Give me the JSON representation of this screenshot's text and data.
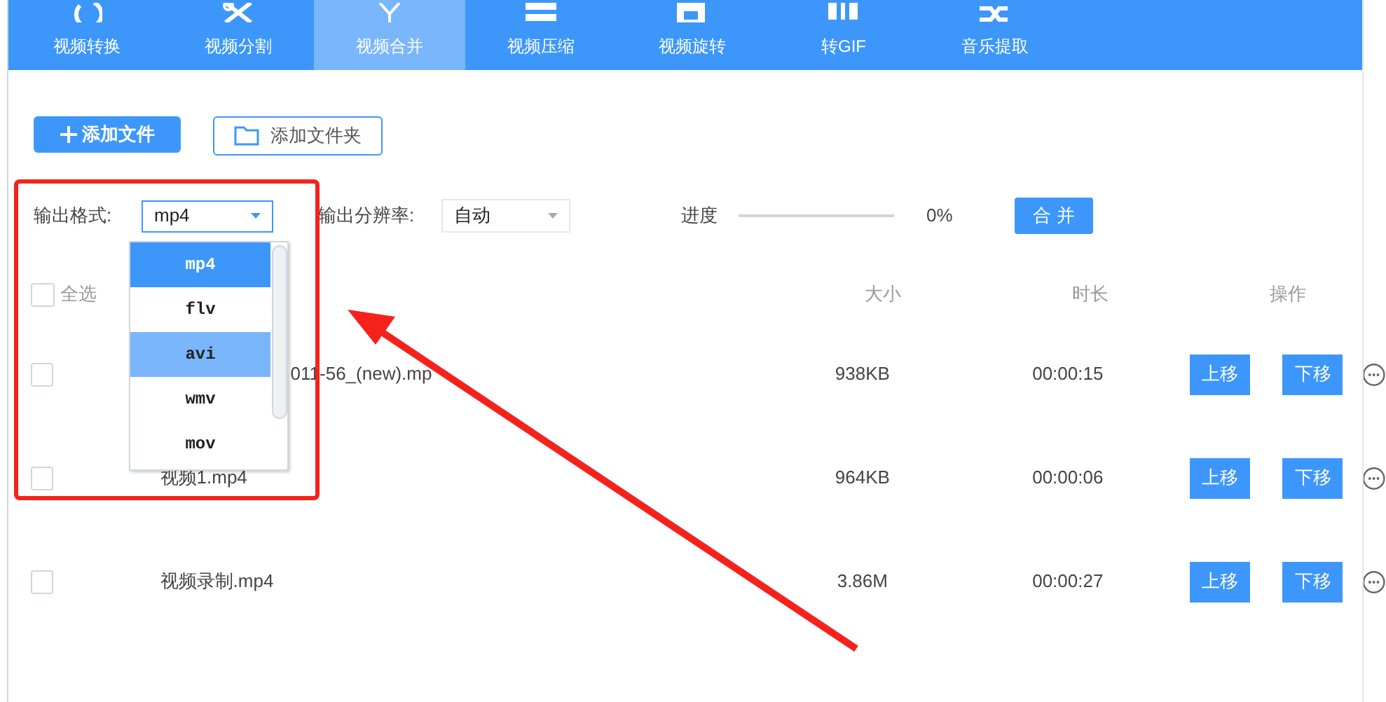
{
  "toolbar": {
    "tabs": [
      {
        "label": "视频转换",
        "selected": false
      },
      {
        "label": "视频分割",
        "selected": false
      },
      {
        "label": "视频合并",
        "selected": true
      },
      {
        "label": "视频压缩",
        "selected": false
      },
      {
        "label": "视频旋转",
        "selected": false
      },
      {
        "label": "转GIF",
        "selected": false
      },
      {
        "label": "音乐提取",
        "selected": false
      }
    ]
  },
  "actions": {
    "add_file": "添加文件",
    "add_folder": "添加文件夹"
  },
  "settings": {
    "format_label": "输出格式:",
    "format_value": "mp4",
    "resolution_label": "输出分辨率:",
    "resolution_value": "自动",
    "progress_label": "进度",
    "progress": {
      "level": 0
    },
    "progress_reading": "0%",
    "merge_button": "合 并"
  },
  "format_dropdown": {
    "options": [
      {
        "label": "mp4",
        "selected": true,
        "highlighted": false
      },
      {
        "label": "flv",
        "selected": false,
        "highlighted": false
      },
      {
        "label": "avi",
        "selected": false,
        "highlighted": true
      },
      {
        "label": "wmv",
        "selected": false,
        "highlighted": false
      },
      {
        "label": "mov",
        "selected": false,
        "highlighted": false
      }
    ]
  },
  "table": {
    "select_all": {
      "label": "全选",
      "checked": false
    },
    "columns": [
      "大小",
      "时长",
      "操作"
    ],
    "rows": [
      {
        "checked": false,
        "name": "011-56_(new).mp",
        "size": "938KB",
        "duration": "00:00:15",
        "up": "上移",
        "down": "下移"
      },
      {
        "checked": false,
        "name": "视频1.mp4",
        "size": "964KB",
        "duration": "00:00:06",
        "up": "上移",
        "down": "下移"
      },
      {
        "checked": false,
        "name": "视频录制.mp4",
        "size": "3.86M",
        "duration": "00:00:27",
        "up": "上移",
        "down": "下移"
      }
    ]
  }
}
